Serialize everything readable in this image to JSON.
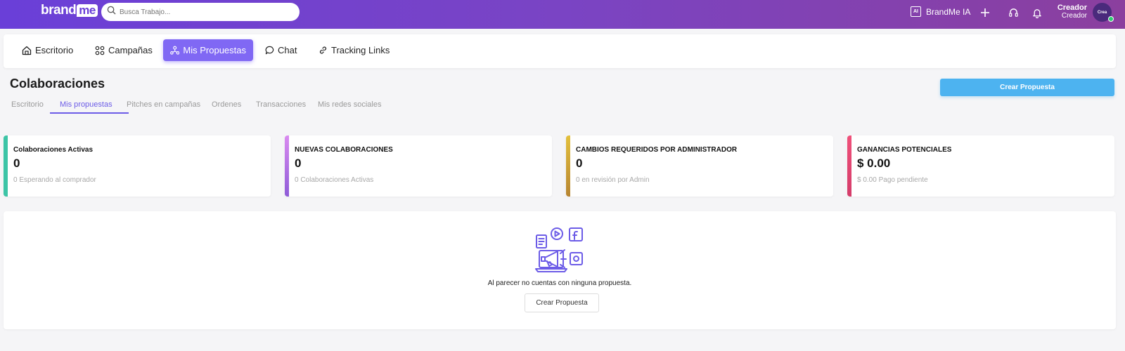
{
  "header": {
    "logo_brand": "brand",
    "logo_me": "me",
    "search_placeholder": "Busca Trabajo...",
    "ai_badge": "AI",
    "ai_label": "BrandMe IA",
    "user_name": "Creador",
    "user_role": "Creador",
    "avatar_text": "Crea"
  },
  "nav": {
    "items": [
      {
        "label": "Escritorio",
        "icon": "home-icon"
      },
      {
        "label": "Campañas",
        "icon": "campaigns-icon"
      },
      {
        "label": "Mis Propuestas",
        "icon": "proposals-icon",
        "active": true
      },
      {
        "label": "Chat",
        "icon": "chat-icon"
      },
      {
        "label": "Tracking Links",
        "icon": "link-icon"
      }
    ]
  },
  "page": {
    "title": "Colaboraciones",
    "create_button": "Crear Propuesta",
    "subtabs": [
      {
        "label": "Escritorio"
      },
      {
        "label": "Mis propuestas",
        "active": true
      },
      {
        "label": "Pitches en campañas"
      },
      {
        "label": "Ordenes"
      },
      {
        "label": "Transacciones"
      },
      {
        "label": "Mis redes sociales"
      }
    ]
  },
  "stats": [
    {
      "label": "Colaboraciones Activas",
      "value": "0",
      "sub": "0 Esperando al comprador",
      "color": "#3cc4a6"
    },
    {
      "label": "NUEVAS COLABORACIONES",
      "value": "0",
      "sub": "0 Colaboraciones Activas",
      "color": "#9b6be0"
    },
    {
      "label": "CAMBIOS REQUERIDOS POR ADMINISTRADOR",
      "value": "0",
      "sub": "0 en revisión por Admin",
      "color": "#d1a43a"
    },
    {
      "label": "GANANCIAS POTENCIALES",
      "value": "$ 0.00",
      "sub": "$ 0.00 Pago pendiente",
      "color": "#e8456b"
    }
  ],
  "empty": {
    "message": "Al parecer no cuentas con ninguna propuesta.",
    "button": "Crear Propuesta"
  },
  "colors": {
    "accent": "#8068f4",
    "create": "#4db3f0",
    "illustration": "#6c5ce7"
  }
}
